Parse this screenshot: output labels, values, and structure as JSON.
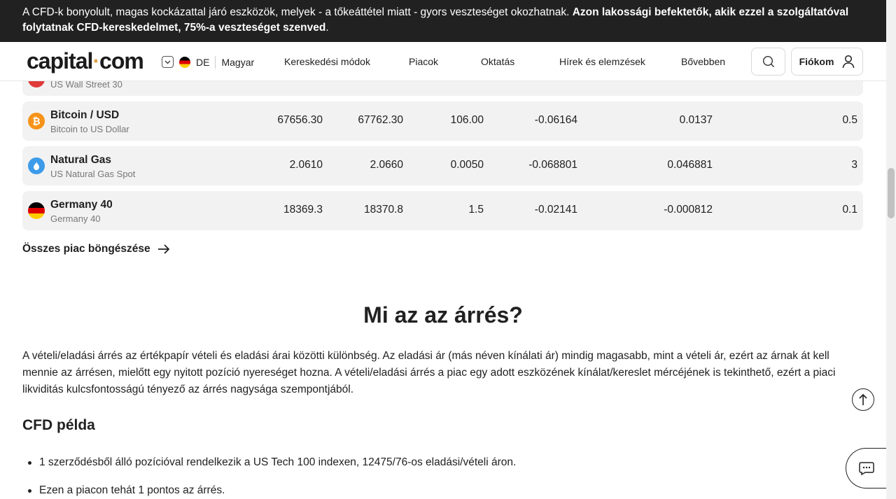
{
  "risk_banner": {
    "text": "A CFD-k bonyolult, magas kockázattal járó eszközök, melyek - a tőkeáttétel miatt - gyors veszteséget okozhatnak. ",
    "bold_text": "Azon lakossági befektetők, akik ezzel a szolgáltatóval folytatnak CFD-kereskedelmet, 75%-a veszteséget szenved",
    "tail": "."
  },
  "header": {
    "logo_main": "capital",
    "logo_dot": "·",
    "logo_tail": "com",
    "lang_code": "DE",
    "language": "Magyar",
    "nav": [
      "Kereskedési módok",
      "Piacok",
      "Oktatás",
      "Hírek és elemzések",
      "Bővebben"
    ],
    "account_label": "Fiókom"
  },
  "table": {
    "partial_row_sub": "US Wall Street 30",
    "rows": [
      {
        "name": "Bitcoin / USD",
        "sub": "Bitcoin to US Dollar",
        "sell": "67656.30",
        "buy": "67762.30",
        "spread": "106.00",
        "long_swap": "-0.06164",
        "short_swap": "0.0137",
        "min": "0.5",
        "icon_color": "#f7931a",
        "icon": "bitcoin-icon"
      },
      {
        "name": "Natural Gas",
        "sub": "US Natural Gas Spot",
        "sell": "2.0610",
        "buy": "2.0660",
        "spread": "0.0050",
        "long_swap": "-0.068801",
        "short_swap": "0.046881",
        "min": "3",
        "icon_color": "#3d9be9",
        "icon": "flame-icon"
      },
      {
        "name": "Germany 40",
        "sub": "Germany 40",
        "sell": "18369.3",
        "buy": "18370.8",
        "spread": "1.5",
        "long_swap": "-0.02141",
        "short_swap": "-0.000812",
        "min": "0.1",
        "icon_color": "#000000",
        "icon": "germany-flag-icon"
      }
    ]
  },
  "browse_link": "Összes piac böngészése",
  "section": {
    "title": "Mi az az árrés?",
    "paragraph": "A vételi/eladási árrés az értékpapír vételi és eladási árai közötti különbség. Az eladási ár (más néven kínálati ár) mindig magasabb, mint a vételi ár, ezért az árnak át kell mennie az árrésen, mielőtt egy nyitott pozíció nyereséget hozna. A vételi/eladási árrés a piac egy adott eszközének kínálat/kereslet mércéjének is tekinthető, ezért a piaci likviditás kulcsfontosságú tényező az árrés nagysága szempontjából.",
    "subtitle": "CFD példa",
    "bullets": [
      "1 szerződésből álló pozícióval rendelkezik a US Tech 100 indexen, 12475/76-os eladási/vételi áron.",
      "Ezen a piacon tehát 1 pontos az árrés."
    ]
  }
}
